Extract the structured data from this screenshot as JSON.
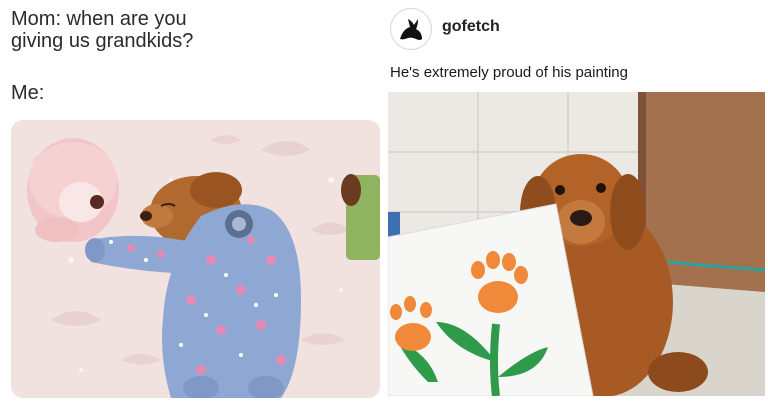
{
  "meme": {
    "line1": "Mom: when are you",
    "line2": "giving us grandkids?",
    "line3": "Me:"
  },
  "post": {
    "username": "gofetch",
    "text": "He's extremely proud of his painting",
    "avatar_icon": "dog-silhouette-icon"
  },
  "images": {
    "left_photo": "puppy-in-pajamas-photo",
    "right_photo": "dog-with-paw-painting-photo"
  },
  "colors": {
    "blanket": "#f3e4e2",
    "pajamas": "#8ea7d3",
    "dog_fur": "#a85a24",
    "paw_paint": "#f08a3a",
    "stem_paint": "#2f9a4a"
  }
}
